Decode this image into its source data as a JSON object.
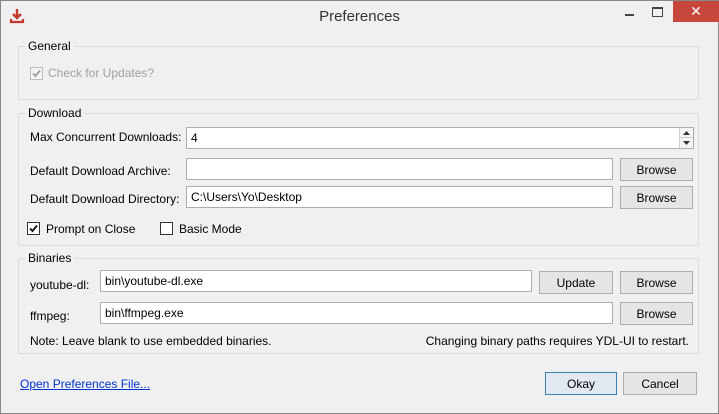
{
  "window": {
    "title": "Preferences",
    "close_glyph": "✕"
  },
  "general": {
    "legend": "General",
    "check_updates_label": "Check for Updates?",
    "check_updates_checked": true,
    "check_updates_enabled": false
  },
  "download": {
    "legend": "Download",
    "max_concurrent_label": "Max Concurrent Downloads:",
    "max_concurrent_value": "4",
    "archive_label": "Default Download Archive:",
    "archive_value": "",
    "directory_label": "Default Download Directory:",
    "directory_value": "C:\\Users\\Yo\\Desktop",
    "browse_label": "Browse",
    "prompt_on_close_label": "Prompt on Close",
    "prompt_on_close_checked": true,
    "basic_mode_label": "Basic Mode",
    "basic_mode_checked": false
  },
  "binaries": {
    "legend": "Binaries",
    "youtube_dl_label": "youtube-dl:",
    "youtube_dl_value": "bin\\youtube-dl.exe",
    "update_label": "Update",
    "ffmpeg_label": "ffmpeg:",
    "ffmpeg_value": "bin\\ffmpeg.exe",
    "browse_label": "Browse",
    "note_left": "Note: Leave blank to use embedded binaries.",
    "note_right": "Changing binary paths requires YDL-UI to restart."
  },
  "footer": {
    "open_prefs_link": "Open Preferences File...",
    "ok_label": "Okay",
    "cancel_label": "Cancel"
  },
  "icons": {
    "app": "download-icon",
    "minimize": "minimize-icon",
    "maximize": "maximize-icon",
    "close": "close-icon",
    "check": "checkmark-icon",
    "spin_up": "spin-up-icon",
    "spin_down": "spin-down-icon"
  },
  "colors": {
    "close_button": "#c7463b",
    "app_icon": "#c0392b",
    "link": "#0033cc",
    "default_button_border": "#3c7fb1"
  }
}
